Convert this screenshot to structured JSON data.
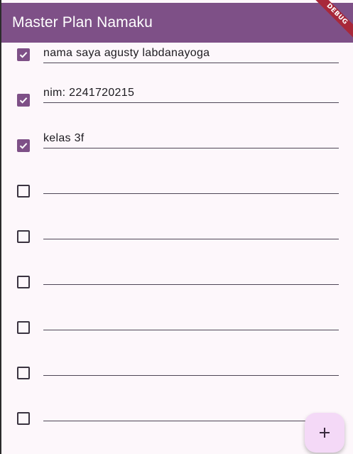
{
  "app": {
    "title": "Master Plan Namaku",
    "debug_label": "DEBUG"
  },
  "tasks": [
    {
      "text": "nama saya agusty labdanayoga",
      "done": true
    },
    {
      "text": "nim: 2241720215",
      "done": true
    },
    {
      "text": "kelas 3f",
      "done": true
    },
    {
      "text": "",
      "done": false
    },
    {
      "text": "",
      "done": false
    },
    {
      "text": "",
      "done": false
    },
    {
      "text": "",
      "done": false
    },
    {
      "text": "",
      "done": false
    },
    {
      "text": "",
      "done": false
    }
  ],
  "fab": {
    "icon": "add-icon"
  },
  "colors": {
    "appbar": "#7e5087",
    "checked": "#7e5087",
    "background": "#fdf7fb",
    "fab": "#f4d9f7"
  }
}
